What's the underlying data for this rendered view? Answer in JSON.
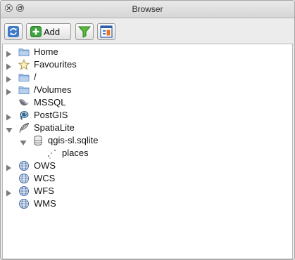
{
  "window": {
    "title": "Browser"
  },
  "toolbar": {
    "add_label": "Add"
  },
  "tree": [
    {
      "label": "Home",
      "icon": "folder-icon",
      "expandable": true,
      "expanded": false,
      "depth": 0
    },
    {
      "label": "Favourites",
      "icon": "star-icon",
      "expandable": true,
      "expanded": false,
      "depth": 0
    },
    {
      "label": "/",
      "icon": "folder-icon",
      "expandable": true,
      "expanded": false,
      "depth": 0
    },
    {
      "label": "/Volumes",
      "icon": "folder-icon",
      "expandable": true,
      "expanded": false,
      "depth": 0
    },
    {
      "label": "MSSQL",
      "icon": "mssql-icon",
      "expandable": false,
      "expanded": false,
      "depth": 0
    },
    {
      "label": "PostGIS",
      "icon": "postgis-elephant-icon",
      "expandable": true,
      "expanded": false,
      "depth": 0
    },
    {
      "label": "SpatiaLite",
      "icon": "spatialite-feather-icon",
      "expandable": true,
      "expanded": true,
      "depth": 0
    },
    {
      "label": "qgis-sl.sqlite",
      "icon": "database-icon",
      "expandable": true,
      "expanded": true,
      "depth": 1
    },
    {
      "label": "places",
      "icon": "point-layer-icon",
      "expandable": false,
      "expanded": false,
      "depth": 2
    },
    {
      "label": "OWS",
      "icon": "globe-icon",
      "expandable": true,
      "expanded": false,
      "depth": 0
    },
    {
      "label": "WCS",
      "icon": "globe-icon",
      "expandable": false,
      "expanded": false,
      "depth": 0
    },
    {
      "label": "WFS",
      "icon": "globe-icon",
      "expandable": true,
      "expanded": false,
      "depth": 0
    },
    {
      "label": "WMS",
      "icon": "globe-icon",
      "expandable": false,
      "expanded": false,
      "depth": 0
    }
  ]
}
